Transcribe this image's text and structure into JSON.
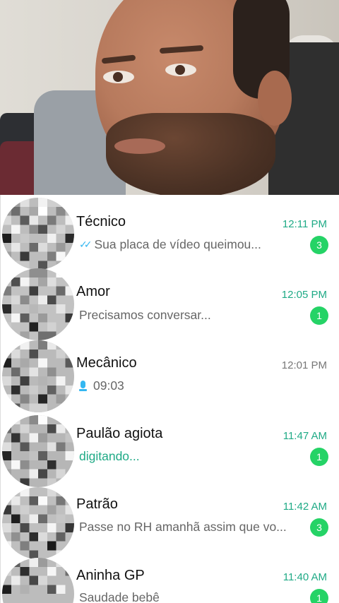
{
  "chats": [
    {
      "name": "Técnico",
      "time": "12:11 PM",
      "preview": "Sua placa de vídeo queimou...",
      "unread": "3",
      "status_icon": "double-check-icon"
    },
    {
      "name": "Amor",
      "time": "12:05 PM",
      "preview": "Precisamos conversar...",
      "unread": "1"
    },
    {
      "name": "Mecânico",
      "time": "12:01 PM",
      "preview": "09:03",
      "status_icon": "microphone-icon"
    },
    {
      "name": "Paulão agiota",
      "time": "11:47 AM",
      "preview": "digitando...",
      "unread": "1"
    },
    {
      "name": "Patrão",
      "time": "11:42 AM",
      "preview": "Passe no RH amanhã assim que vo...",
      "unread": "3"
    },
    {
      "name": "Aninha GP",
      "time": "11:40 AM",
      "preview": "Saudade bebê",
      "unread": "1"
    }
  ],
  "colors": {
    "accent_green": "#1faa86",
    "badge_green": "#25d366",
    "tick_blue": "#34b7f1"
  }
}
